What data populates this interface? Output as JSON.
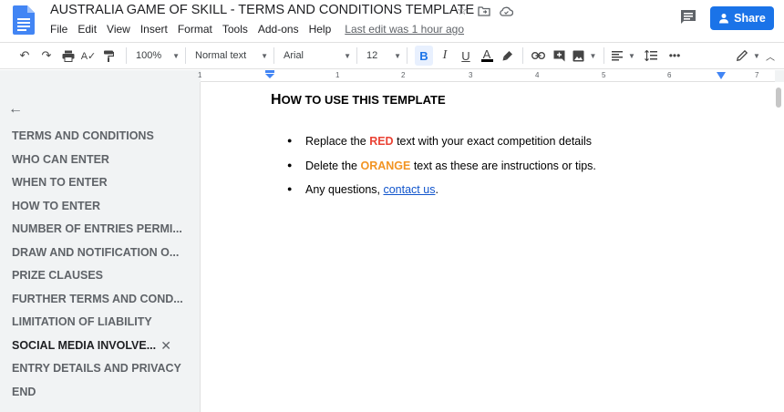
{
  "doc": {
    "title": "AUSTRALIA GAME OF SKILL - TERMS AND CONDITIONS TEMPLATE",
    "last_edit": "Last edit was 1 hour ago",
    "share_label": "Share"
  },
  "menu": [
    "File",
    "Edit",
    "View",
    "Insert",
    "Format",
    "Tools",
    "Add-ons",
    "Help"
  ],
  "toolbar": {
    "zoom": "100%",
    "style": "Normal text",
    "font": "Arial",
    "size": "12"
  },
  "ruler": [
    "1",
    "1",
    "2",
    "3",
    "4",
    "5",
    "6",
    "7"
  ],
  "outline": [
    "TERMS AND CONDITIONS",
    "WHO CAN ENTER",
    "WHEN TO ENTER",
    "HOW TO ENTER",
    "NUMBER OF ENTRIES PERMI...",
    "DRAW AND NOTIFICATION O...",
    "PRIZE CLAUSES",
    "FURTHER TERMS AND COND...",
    "LIMITATION OF LIABILITY",
    "SOCIAL MEDIA INVOLVE...",
    "ENTRY DETAILS AND PRIVACY",
    "END"
  ],
  "body": {
    "heading_first": "H",
    "heading_rest": "OW TO USE THIS TEMPLATE",
    "b1_pre": "Replace the ",
    "b1_red": "RED",
    "b1_post": " text with your exact competition details",
    "b2_pre": "Delete the ",
    "b2_orange": "ORANGE",
    "b2_post": " text as these are instructions or tips.",
    "b3_pre": "Any questions, ",
    "b3_link": "contact us",
    "b3_post": "."
  },
  "colors": {
    "accent": "#1a73e8",
    "red_text": "#ea4335",
    "orange_text": "#f29423",
    "link": "#1155cc"
  }
}
